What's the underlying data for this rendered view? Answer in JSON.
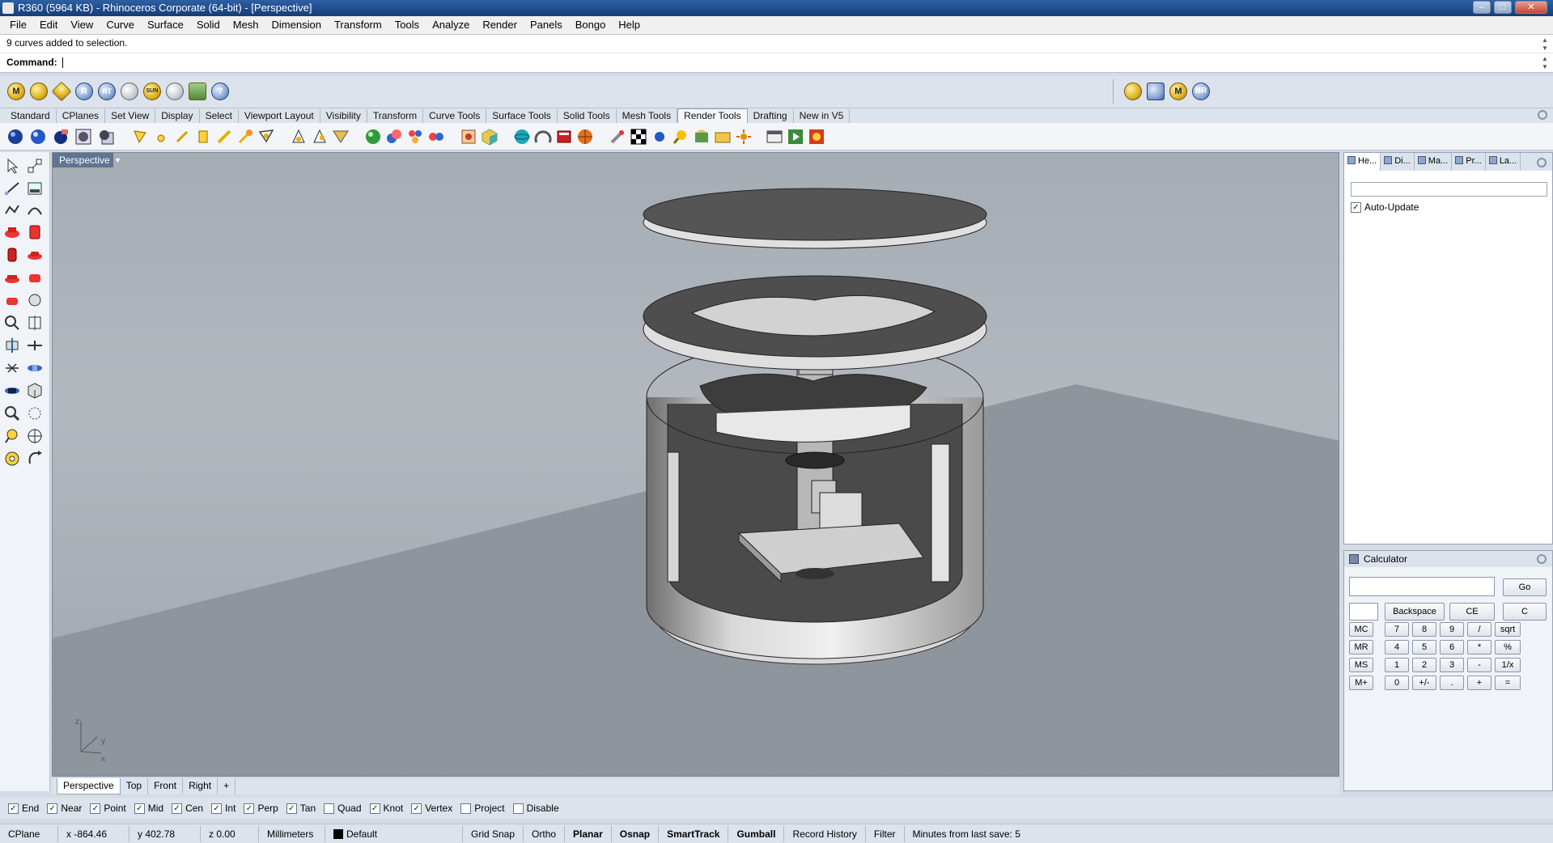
{
  "window": {
    "title": "R360 (5964 KB) - Rhinoceros Corporate (64-bit) - [Perspective]"
  },
  "menu": [
    "File",
    "Edit",
    "View",
    "Curve",
    "Surface",
    "Solid",
    "Mesh",
    "Dimension",
    "Transform",
    "Tools",
    "Analyze",
    "Render",
    "Panels",
    "Bongo",
    "Help"
  ],
  "command": {
    "history": "9 curves added to selection.",
    "prompt_label": "Command:",
    "value": ""
  },
  "toolbar_top": {
    "left_icons": [
      "M",
      "gear-badge",
      "tag",
      "R",
      "RT",
      "sun-rays",
      "SUN",
      "light",
      "landscape",
      "?"
    ],
    "right_icons": [
      "globe",
      "building",
      "M",
      "BR"
    ]
  },
  "toolbar_tabs": [
    "Standard",
    "CPlanes",
    "Set View",
    "Display",
    "Select",
    "Viewport Layout",
    "Visibility",
    "Transform",
    "Curve Tools",
    "Surface Tools",
    "Solid Tools",
    "Mesh Tools",
    "Render Tools",
    "Drafting",
    "New in V5"
  ],
  "toolbar_tabs_active": "Render Tools",
  "viewport": {
    "label": "Perspective",
    "axis_labels": {
      "z": "z",
      "x": "x",
      "y": "y"
    }
  },
  "viewport_tabs": [
    "Perspective",
    "Top",
    "Front",
    "Right",
    "+"
  ],
  "viewport_tab_active": "Perspective",
  "osnaps": [
    {
      "label": "End",
      "checked": true
    },
    {
      "label": "Near",
      "checked": true
    },
    {
      "label": "Point",
      "checked": true
    },
    {
      "label": "Mid",
      "checked": true
    },
    {
      "label": "Cen",
      "checked": true
    },
    {
      "label": "Int",
      "checked": true
    },
    {
      "label": "Perp",
      "checked": true
    },
    {
      "label": "Tan",
      "checked": true
    },
    {
      "label": "Quad",
      "checked": false
    },
    {
      "label": "Knot",
      "checked": true
    },
    {
      "label": "Vertex",
      "checked": true
    },
    {
      "label": "Project",
      "checked": false
    },
    {
      "label": "Disable",
      "checked": false
    }
  ],
  "status": {
    "cplane": "CPlane",
    "x": "x -864.46",
    "y": "y 402.78",
    "z": "z 0.00",
    "units": "Millimeters",
    "layer": "Default",
    "grid_snap": "Grid Snap",
    "ortho": "Ortho",
    "planar": "Planar",
    "osnap": "Osnap",
    "smarttrack": "SmartTrack",
    "gumball": "Gumball",
    "record_history": "Record History",
    "filter": "Filter",
    "save_info": "Minutes from last save: 5"
  },
  "right_panel": {
    "tabs": [
      "He...",
      "Di...",
      "Ma...",
      "Pr...",
      "La..."
    ],
    "auto_update_label": "Auto-Update",
    "auto_update_checked": true
  },
  "calculator": {
    "title": "Calculator",
    "display": "",
    "go": "Go",
    "backspace": "Backspace",
    "ce": "CE",
    "c": "C",
    "rows": [
      [
        "MC",
        "7",
        "8",
        "9",
        "/",
        "sqrt"
      ],
      [
        "MR",
        "4",
        "5",
        "6",
        "*",
        "%"
      ],
      [
        "MS",
        "1",
        "2",
        "3",
        "-",
        "1/x"
      ],
      [
        "M+",
        "0",
        "+/-",
        ".",
        "+",
        "="
      ]
    ]
  }
}
